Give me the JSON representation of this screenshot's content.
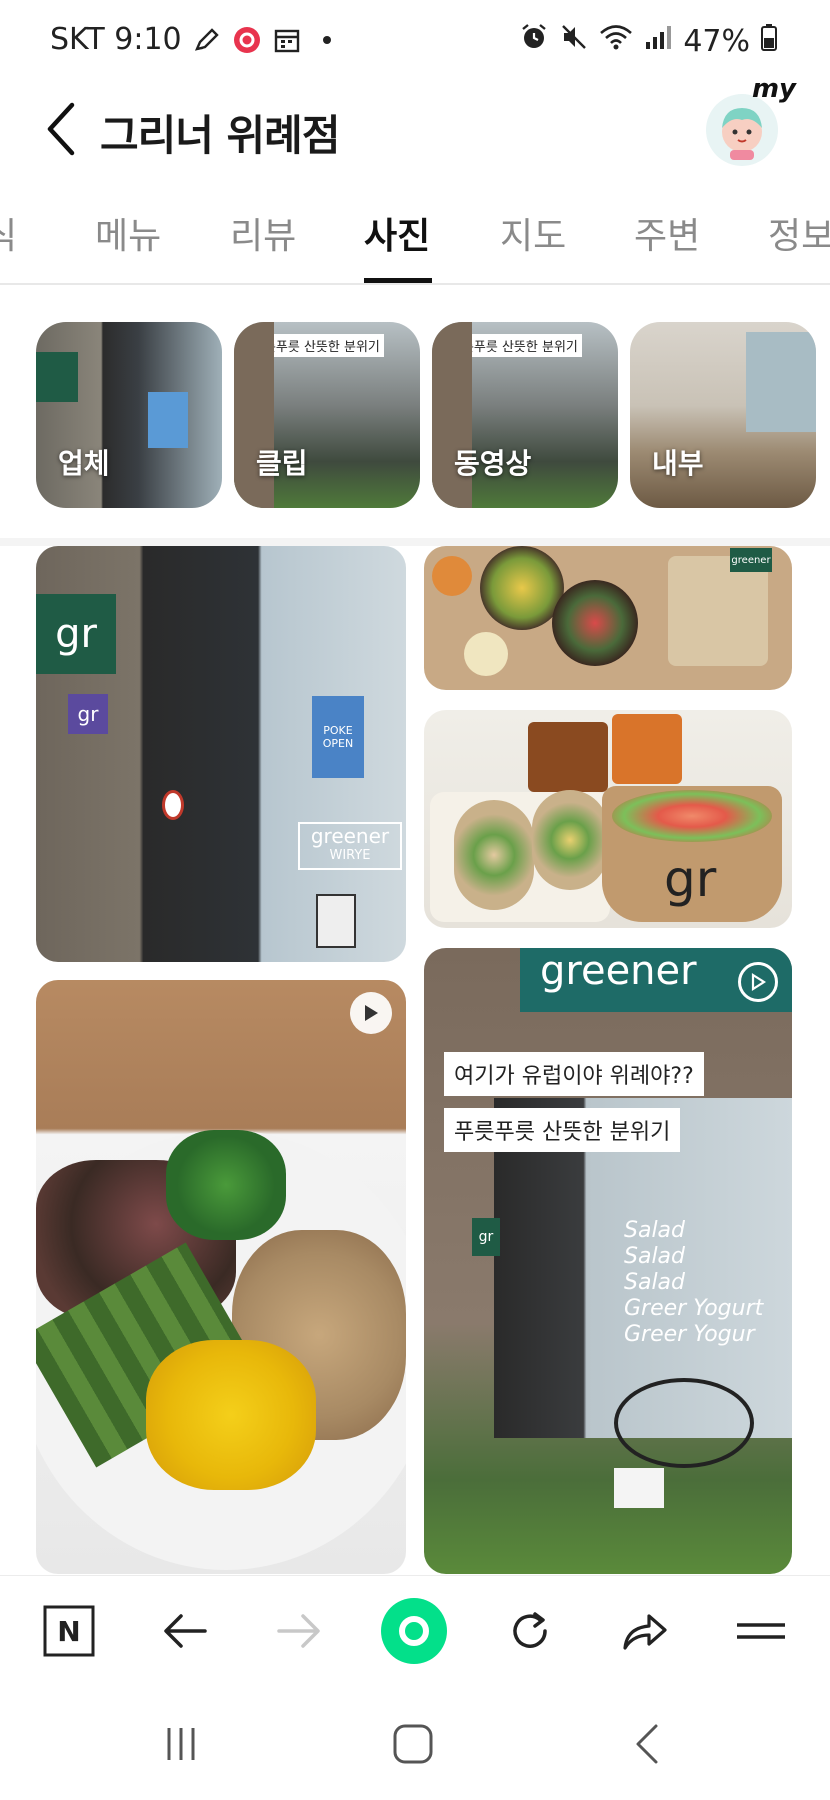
{
  "status_bar": {
    "carrier_time": "SKT 9:10",
    "battery": "47%",
    "icons": [
      "pen-icon",
      "record-icon",
      "calendar-icon",
      "dot-icon",
      "alarm-icon",
      "mute-icon",
      "wifi-icon",
      "signal-icon",
      "battery-icon"
    ]
  },
  "header": {
    "title": "그리너 위례점",
    "avatar_text": "my"
  },
  "tabs": [
    {
      "label": "식"
    },
    {
      "label": "메뉴"
    },
    {
      "label": "리뷰"
    },
    {
      "label": "사진",
      "active": true
    },
    {
      "label": "지도"
    },
    {
      "label": "주변"
    },
    {
      "label": "정보"
    }
  ],
  "chips": [
    {
      "label": "업체"
    },
    {
      "label": "클립",
      "caption": "푸릇푸릇 산뜻한 분위기"
    },
    {
      "label": "동영상",
      "caption": "푸릇푸릇 산뜻한 분위기"
    },
    {
      "label": "내부"
    }
  ],
  "photos": {
    "storefront": {
      "logo_text": "gr",
      "small_logo_text": "gr",
      "poster_text": "POKE OPEN",
      "sign_text": "greener",
      "sign_sub": "WIRYE"
    },
    "bowls_top": {
      "badge_text": "greener"
    },
    "wraps": {
      "cup_text": "gr"
    },
    "video_storefront": {
      "sign_text": "greener",
      "caption_1": "여기가 유럽이야 위례야??",
      "caption_2": "푸릇푸릇 산뜻한 분위기",
      "window_text": [
        "Salad",
        "Salad",
        "Salad",
        "Greer Yogurt",
        "Greer Yogur"
      ],
      "small_sign": "gr"
    }
  },
  "toolbar": {
    "naver_label": "N"
  },
  "colors": {
    "accent_green": "#03c75a",
    "greener_brand": "#1f5b45"
  }
}
